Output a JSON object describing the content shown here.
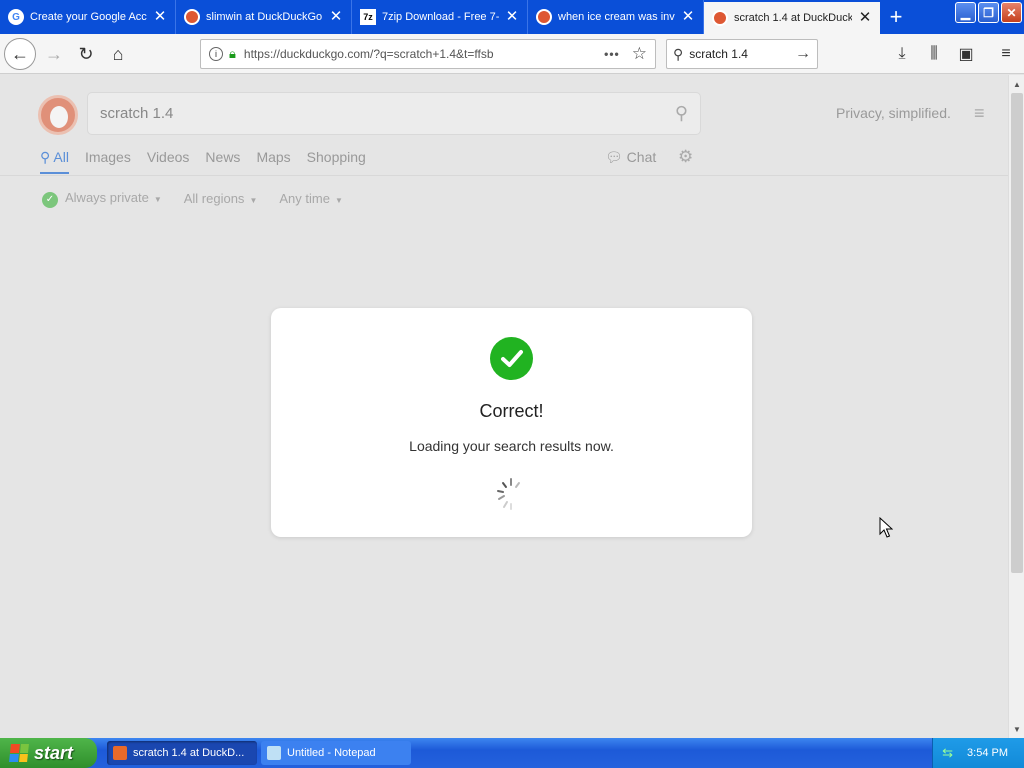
{
  "browser": {
    "tabs": [
      {
        "title": "Create your Google Acc",
        "favicon": "google-icon",
        "active": false
      },
      {
        "title": "slimwin at DuckDuckGo",
        "favicon": "duckduckgo-icon",
        "active": false
      },
      {
        "title": "7zip Download - Free 7-",
        "favicon": "7zip-icon",
        "active": false
      },
      {
        "title": "when ice cream was inv",
        "favicon": "duckduckgo-icon",
        "active": false
      },
      {
        "title": "scratch 1.4 at DuckDuck",
        "favicon": "duckduckgo-icon",
        "active": true
      }
    ],
    "url": "https://duckduckgo.com/?q=scratch+1.4&t=ffsb",
    "search_value": "scratch 1.4",
    "new_tab_symbol": "+"
  },
  "ddg": {
    "query": "scratch 1.4",
    "tagline": "Privacy, simplified.",
    "nav_tabs": [
      "All",
      "Images",
      "Videos",
      "News",
      "Maps",
      "Shopping"
    ],
    "active_tab": "All",
    "chat_label": "Chat",
    "filters": {
      "privacy": "Always private",
      "region": "All regions",
      "time": "Any time"
    }
  },
  "modal": {
    "title": "Correct!",
    "message": "Loading your search results now."
  },
  "taskbar": {
    "start_label": "start",
    "tasks": [
      {
        "label": "scratch 1.4 at DuckD...",
        "active": true
      },
      {
        "label": "Untitled - Notepad",
        "active": false
      }
    ],
    "clock": "3:54 PM"
  },
  "colors": {
    "titlebar": "#0a4fd8",
    "check_green": "#21b321",
    "ddg_orange": "#de5833",
    "link_blue": "#5b8fd8"
  }
}
